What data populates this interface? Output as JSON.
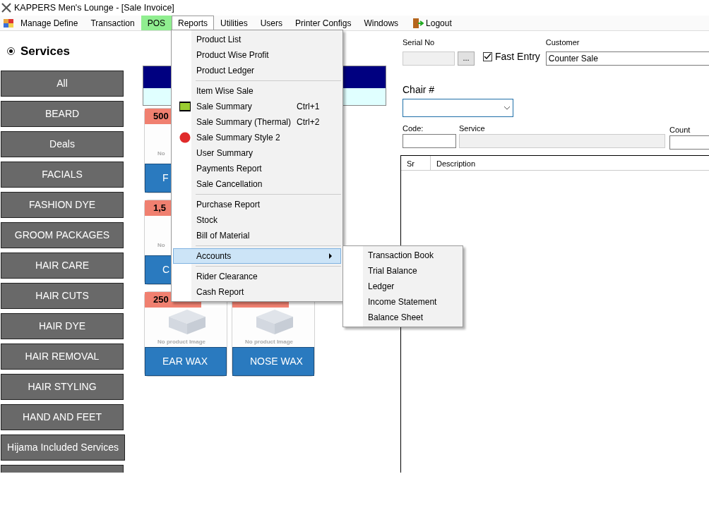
{
  "window": {
    "title": "KAPPERS Men's Lounge - [Sale Invoice]"
  },
  "menu_bar": [
    {
      "label": "Manage Define",
      "selected": false,
      "highlighted": false
    },
    {
      "label": "Transaction",
      "selected": false,
      "highlighted": false
    },
    {
      "label": "POS",
      "selected": false,
      "highlighted": true
    },
    {
      "label": "Reports",
      "selected": true,
      "highlighted": false
    },
    {
      "label": "Utilities",
      "selected": false,
      "highlighted": false
    },
    {
      "label": "Users",
      "selected": false,
      "highlighted": false
    },
    {
      "label": "Printer Configs",
      "selected": false,
      "highlighted": false
    },
    {
      "label": "Windows",
      "selected": false,
      "highlighted": false
    },
    {
      "label": "Logout",
      "selected": false,
      "highlighted": false,
      "kind": "logout"
    }
  ],
  "reports_menu": {
    "sections": [
      [
        {
          "label": "Product List",
          "selected": false
        },
        {
          "label": "Product Wise Profit",
          "selected": false
        },
        {
          "label": "Product Ledger",
          "selected": false
        }
      ],
      [
        {
          "label": "Item Wise Sale",
          "selected": false
        },
        {
          "label": "Sale Summary",
          "shortcut": "Ctrl+1",
          "kind": "report",
          "selected": false
        },
        {
          "label": "Sale Summary (Thermal)",
          "shortcut": "Ctrl+2",
          "selected": false
        },
        {
          "label": "Sale Summary Style 2",
          "kind": "logo",
          "selected": false
        },
        {
          "label": "User Summary",
          "selected": false
        },
        {
          "label": "Payments Report",
          "selected": false
        },
        {
          "label": "Sale Cancellation",
          "selected": false
        }
      ],
      [
        {
          "label": "Purchase Report",
          "selected": false
        },
        {
          "label": "Stock",
          "selected": false
        },
        {
          "label": "Bill of Material",
          "selected": false
        }
      ],
      [
        {
          "label": "Accounts",
          "selected": true,
          "submenu": true
        }
      ],
      [
        {
          "label": "Rider Clearance",
          "selected": false
        },
        {
          "label": "Cash Report",
          "selected": false
        }
      ]
    ]
  },
  "accounts_submenu": [
    "Transaction Book",
    "Trial Balance",
    "Ledger",
    "Income Statement",
    "Balance Sheet"
  ],
  "services": {
    "label": "Services",
    "selected": true
  },
  "categories": [
    {
      "label": "All"
    },
    {
      "label": "BEARD"
    },
    {
      "label": "Deals"
    },
    {
      "label": "FACIALS"
    },
    {
      "label": "FASHION DYE"
    },
    {
      "label": "GROOM PACKAGES"
    },
    {
      "label": "HAIR CARE"
    },
    {
      "label": "HAIR CUTS"
    },
    {
      "label": "HAIR DYE"
    },
    {
      "label": "HAIR REMOVAL"
    },
    {
      "label": "HAIR STYLING"
    },
    {
      "label": "HAND AND FEET"
    },
    {
      "label": "Hijama Included Services"
    }
  ],
  "more_categories_below": true,
  "product_rows": [
    [
      {
        "price": "500",
        "image_text": "No",
        "name": "F",
        "kind": "covered"
      }
    ],
    [
      {
        "price": "1,5",
        "image_text": "No",
        "name": "C",
        "kind": "covered"
      }
    ],
    [
      {
        "price": "250",
        "image_text": "No product Image",
        "name": "EAR WAX",
        "kind": "plain"
      },
      {
        "image_text": "No product Image",
        "name": "NOSE WAX",
        "kind": "plain"
      }
    ]
  ],
  "form": {
    "serial_no_label": "Serial No",
    "browse_button": "...",
    "fast_entry": {
      "label": "Fast Entry",
      "checked": true
    },
    "customer_label": "Customer",
    "customer_value": "Counter Sale",
    "chair_label": "Chair #",
    "code_label": "Code:",
    "service_label": "Service",
    "count_label": "Count"
  },
  "table": {
    "columns": [
      "Sr",
      "Description"
    ]
  }
}
